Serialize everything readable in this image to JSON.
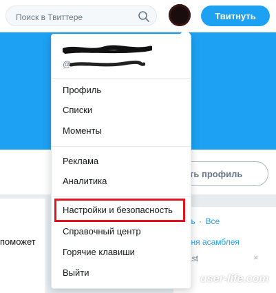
{
  "colors": {
    "accent": "#1da1f2",
    "highlight": "#e0131e"
  },
  "topbar": {
    "search_placeholder": "Поиск в Твиттере",
    "search_icon": "search-icon",
    "tweet_button": "Твитнуть"
  },
  "profile": {
    "edit_button": "ить профиль"
  },
  "left_card": {
    "text": "поможет"
  },
  "right_card": {
    "link_1": "ть",
    "separator": "·",
    "link_2": "Все",
    "item_title": "тня асамблея",
    "item_sub": "ast",
    "close_icon": "close-icon",
    "close_glyph": "×"
  },
  "watermark": "user-life.com",
  "dropdown": {
    "handle_prefix": "@",
    "items": [
      "Профиль",
      "Списки",
      "Моменты",
      "Реклама",
      "Аналитика",
      "Настройки и безопасность",
      "Справочный центр",
      "Горячие клавиши",
      "Выйти"
    ],
    "highlighted_item": "Настройки и безопасность"
  }
}
